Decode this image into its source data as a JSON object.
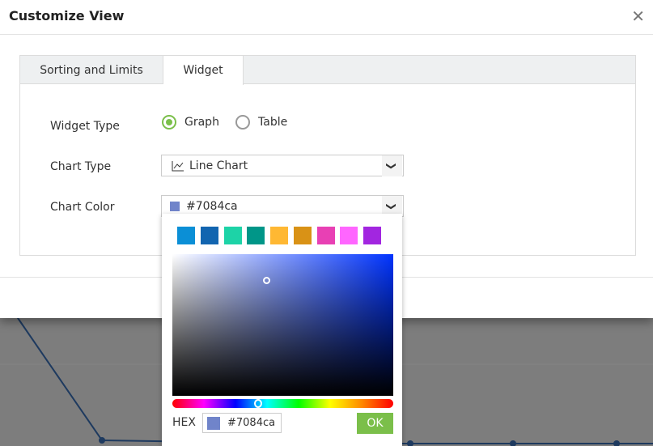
{
  "dialog": {
    "title": "Customize View",
    "close_icon": "close-icon"
  },
  "tabs": [
    {
      "label": "Sorting and Limits",
      "active": false
    },
    {
      "label": "Widget",
      "active": true
    }
  ],
  "form": {
    "widget_type": {
      "label": "Widget Type",
      "options": [
        {
          "label": "Graph",
          "selected": true
        },
        {
          "label": "Table",
          "selected": false
        }
      ]
    },
    "chart_type": {
      "label": "Chart Type",
      "value": "Line Chart",
      "icon": "line-chart-icon"
    },
    "chart_color": {
      "label": "Chart Color",
      "value": "#7084ca"
    }
  },
  "picker": {
    "swatches": [
      "#0b8fd6",
      "#1265b0",
      "#1dd3a7",
      "#009688",
      "#ffb833",
      "#d99216",
      "#e840b4",
      "#ff66ff",
      "#a226e0"
    ],
    "hex_label": "HEX",
    "hex_value": "#7084ca",
    "ok_label": "OK",
    "selected_color": "#7084ca"
  },
  "background_chart": {
    "line_color": "#1e3a5f"
  }
}
